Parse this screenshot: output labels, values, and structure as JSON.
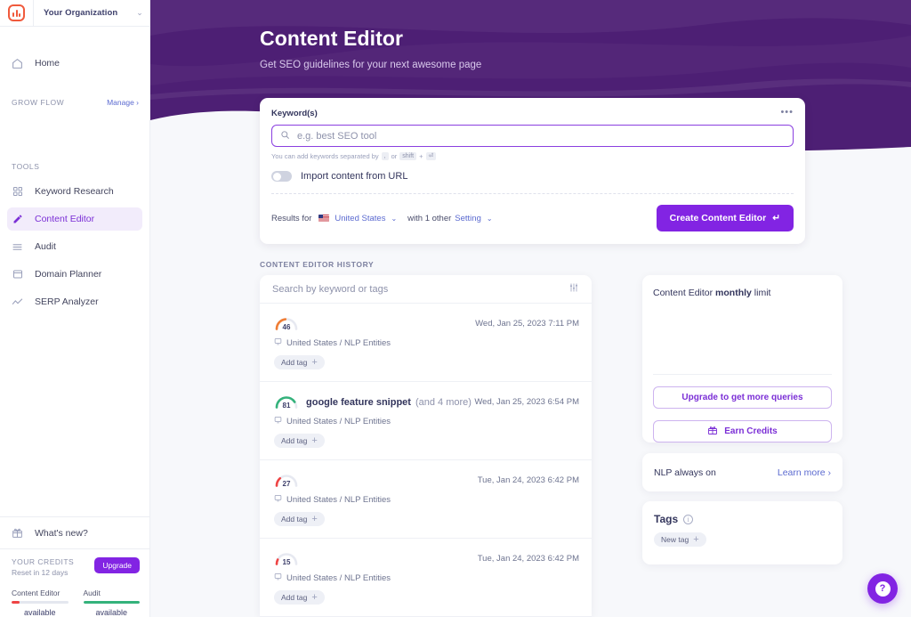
{
  "sidebar": {
    "org_name": "Your Organization",
    "home_label": "Home",
    "grow_flow_label": "GROW FLOW",
    "manage_label": "Manage",
    "tools_label": "TOOLS",
    "tools": [
      {
        "label": "Keyword Research",
        "icon": "grid-icon",
        "active": false
      },
      {
        "label": "Content Editor",
        "icon": "pencil-icon",
        "active": true
      },
      {
        "label": "Audit",
        "icon": "list-icon",
        "active": false
      },
      {
        "label": "Domain Planner",
        "icon": "window-icon",
        "active": false
      },
      {
        "label": "SERP Analyzer",
        "icon": "chart-line-icon",
        "active": false
      }
    ],
    "whats_new_label": "What's new?",
    "credits": {
      "title": "YOUR CREDITS",
      "reset": "Reset in 12 days",
      "upgrade_label": "Upgrade",
      "meters": [
        {
          "name": "Content Editor",
          "value": "available",
          "fill_pct": 14,
          "color": "#ef4444"
        },
        {
          "name": "Audit",
          "value": "available",
          "fill_pct": 100,
          "color": "#34b27b"
        }
      ]
    }
  },
  "hero": {
    "title": "Content Editor",
    "subtitle": "Get SEO guidelines for your next awesome page",
    "bg_color": "#4d1f74"
  },
  "keyword_card": {
    "label": "Keyword(s)",
    "menu_dots": "•••",
    "input_placeholder": "e.g. best SEO tool",
    "input_value": "",
    "hint_prefix": "You can add keywords separated by",
    "hint_key_comma": ",",
    "hint_or": "or",
    "hint_key_shift": "shift",
    "hint_plus": "+",
    "hint_key_enter": "⏎",
    "import_label": "Import content from URL",
    "import_enabled": false,
    "results_prefix": "Results for",
    "country": "United States",
    "with_other": "with 1 other",
    "setting_label": "Setting",
    "create_button": "Create Content Editor",
    "create_button_key": "↵",
    "accent_color": "#8224e3"
  },
  "history": {
    "section_title": "CONTENT EDITOR HISTORY",
    "search_placeholder": "Search by keyword or tags",
    "filter_icon": "sliders-icon",
    "add_tag_label": "Add tag",
    "rows": [
      {
        "score": 46,
        "score_color": "#f07d34",
        "keyword": "",
        "more": "",
        "date": "Wed, Jan 25, 2023 7:11 PM",
        "meta": "United States / NLP Entities"
      },
      {
        "score": 81,
        "score_color": "#34b27b",
        "keyword": "google feature snippet",
        "more": "(and 4 more)",
        "date": "Wed, Jan 25, 2023 6:54 PM",
        "meta": "United States / NLP Entities"
      },
      {
        "score": 27,
        "score_color": "#ef4444",
        "keyword": "",
        "more": "",
        "date": "Tue, Jan 24, 2023 6:42 PM",
        "meta": "United States / NLP Entities"
      },
      {
        "score": 15,
        "score_color": "#ef4444",
        "keyword": "",
        "more": "",
        "date": "Tue, Jan 24, 2023 6:42 PM",
        "meta": "United States / NLP Entities"
      }
    ]
  },
  "right_panel": {
    "limit_title_a": "Content Editor ",
    "limit_title_b": "monthly",
    "limit_title_c": " limit",
    "upgrade_queries_label": "Upgrade to get more queries",
    "earn_credits_label": "Earn Credits",
    "nlp_label": "NLP always on",
    "learn_more_label": "Learn more",
    "tags_title": "Tags",
    "new_tag_label": "New tag"
  },
  "help": {
    "glyph": "?"
  }
}
